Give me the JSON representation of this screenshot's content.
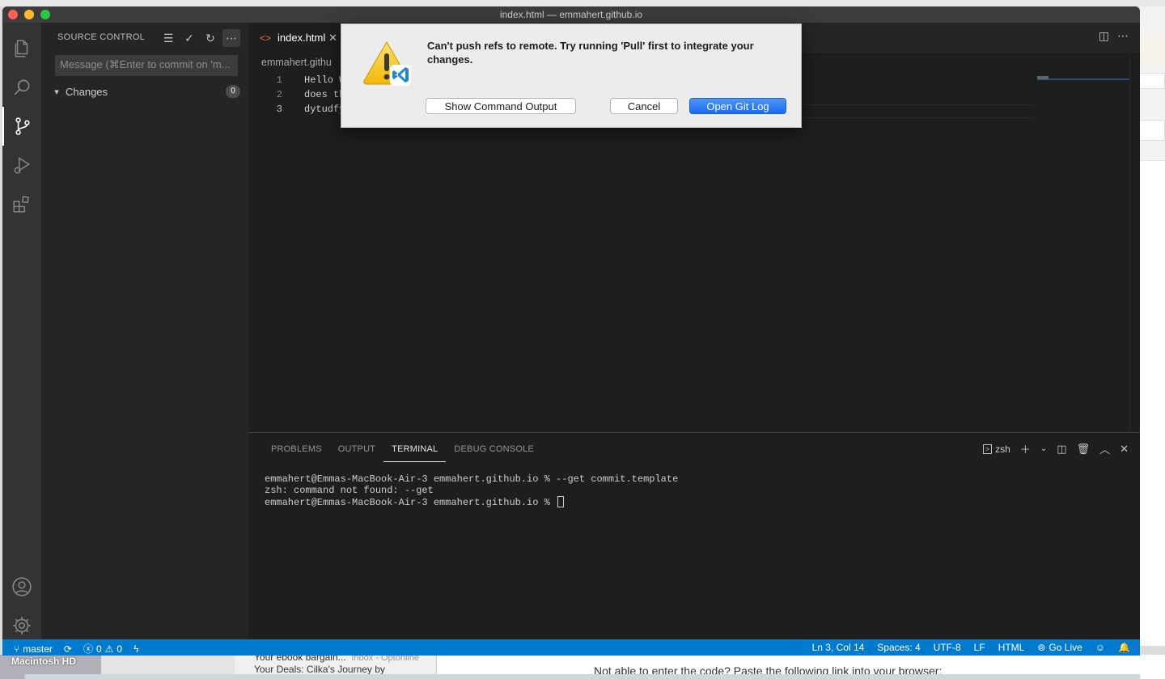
{
  "window": {
    "title": "index.html — emmahert.github.io"
  },
  "activity_bar": {
    "items": [
      {
        "name": "explorer",
        "icon": "files-icon"
      },
      {
        "name": "search",
        "icon": "search-icon"
      },
      {
        "name": "source-control",
        "icon": "source-control-icon"
      },
      {
        "name": "run-debug",
        "icon": "run-debug-icon"
      },
      {
        "name": "extensions",
        "icon": "extensions-icon"
      }
    ],
    "bottom": [
      {
        "name": "accounts",
        "icon": "account-icon"
      },
      {
        "name": "manage",
        "icon": "gear-icon"
      }
    ]
  },
  "sidebar": {
    "title": "SOURCE CONTROL",
    "commit_placeholder": "Message (⌘Enter to commit on 'm...",
    "changes_label": "Changes",
    "changes_count": "0"
  },
  "editor": {
    "tab_label": "index.html",
    "tab_icon": "<>",
    "breadcrumb": "emmahert.githu",
    "lines": [
      {
        "num": "1",
        "text": "Hello W"
      },
      {
        "num": "2",
        "text": "does th"
      },
      {
        "num": "3",
        "text": "dytudfy"
      }
    ]
  },
  "panel": {
    "tabs": [
      "PROBLEMS",
      "OUTPUT",
      "TERMINAL",
      "DEBUG CONSOLE"
    ],
    "active_tab": "TERMINAL",
    "shell": "zsh",
    "terminal_lines": [
      "emmahert@Emmas-MacBook-Air-3 emmahert.github.io % --get commit.template",
      "zsh: command not found: --get",
      "emmahert@Emmas-MacBook-Air-3 emmahert.github.io % "
    ]
  },
  "statusbar": {
    "branch": "master",
    "errors": "0",
    "warnings": "0",
    "position": "Ln 3, Col 14",
    "spaces": "Spaces: 4",
    "encoding": "UTF-8",
    "eol": "LF",
    "language": "HTML",
    "go_live": "Go Live"
  },
  "dialog": {
    "message": "Can't push refs to remote. Try running 'Pull' first to integrate your changes.",
    "buttons": {
      "show_output": "Show Command Output",
      "cancel": "Cancel",
      "open_git_log": "Open Git Log"
    }
  },
  "desktop": {
    "disk_label": "Macintosh HD",
    "mail_subject": "Your ebook bargain...",
    "mail_folder": "Inbox - Optonline",
    "mail_preview": "Your Deals: Cilka's Journey by",
    "web_text": "Not able to enter the code? Paste the following link into your browser:"
  },
  "colors": {
    "statusbar": "#007acc",
    "primary_button": "#1a6af5",
    "activity_bar": "#333333",
    "sidebar": "#252526",
    "editor": "#1e1e1e"
  }
}
